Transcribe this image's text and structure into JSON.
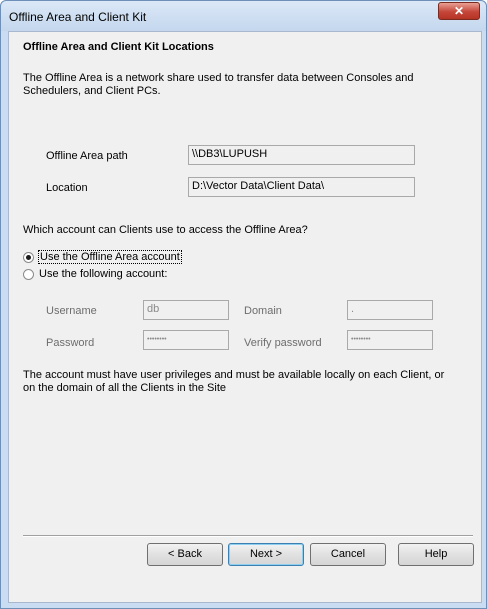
{
  "window": {
    "title": "Offline Area and Client Kit",
    "close_glyph": "✕",
    "close_icon": "close-icon"
  },
  "heading": "Offline Area and Client Kit Locations",
  "description": "The Offline Area is a network share used to transfer data between Consoles and Schedulers, and Client PCs.",
  "offline_area_path": {
    "label": "Offline Area path",
    "value": "\\\\DB3\\LUPUSH"
  },
  "location": {
    "label": "Location",
    "value": "D:\\Vector Data\\Client Data\\"
  },
  "account_question": "Which account can Clients use to access the Offline Area?",
  "radios": {
    "use_offline": {
      "label": "Use the Offline Area account",
      "checked": true
    },
    "use_following": {
      "label": "Use the following account:",
      "checked": false
    }
  },
  "credentials": {
    "username_label": "Username",
    "username_value": "db",
    "domain_label": "Domain",
    "domain_value": ".",
    "password_label": "Password",
    "password_value": "••••••••",
    "verify_label": "Verify password",
    "verify_value": "••••••••"
  },
  "note": "The account must have user privileges and must be available locally on each Client, or on the domain of all the Clients in the Site",
  "buttons": {
    "back": "< Back",
    "next": "Next >",
    "cancel": "Cancel",
    "help": "Help"
  }
}
